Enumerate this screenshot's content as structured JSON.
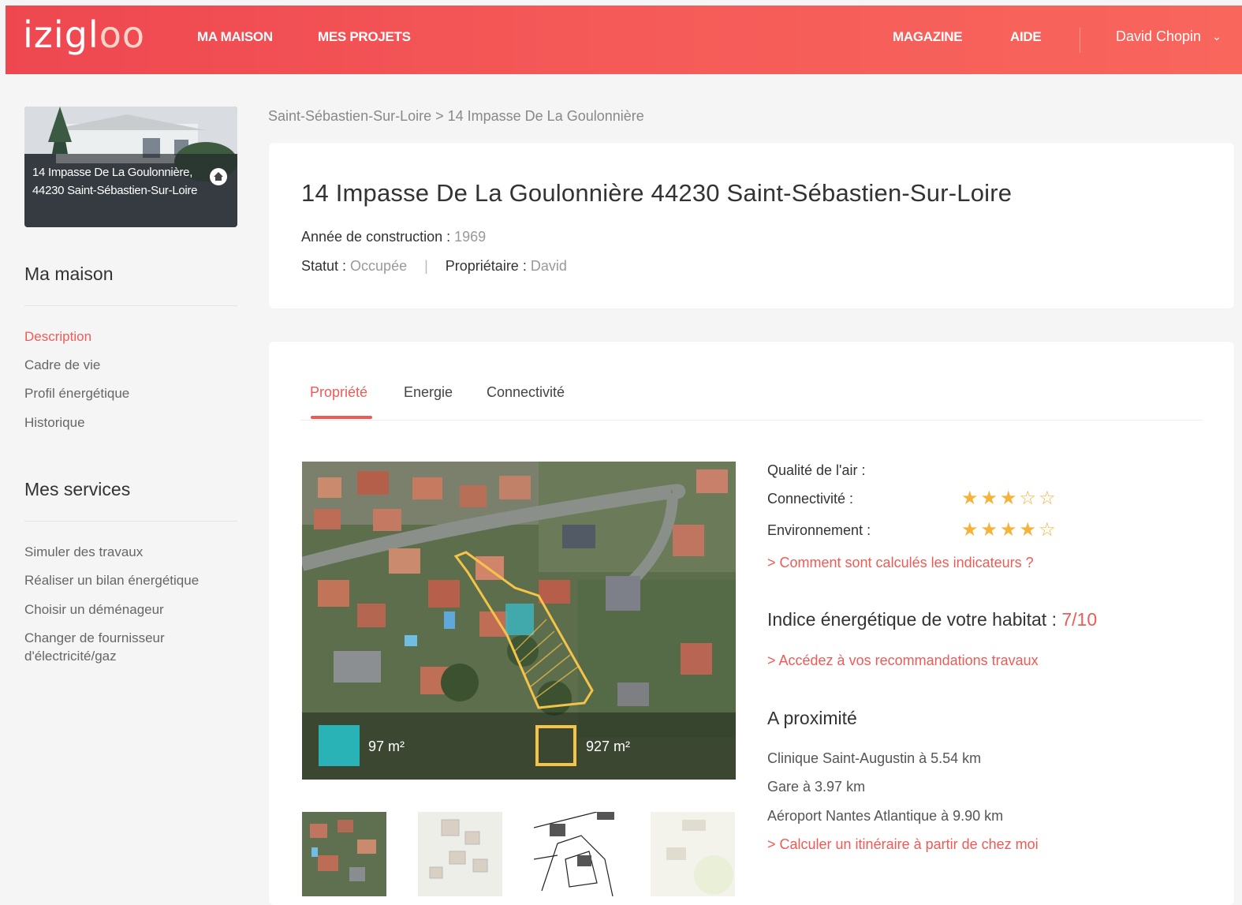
{
  "header": {
    "logo_main": "izigl",
    "logo_oo": "oo",
    "nav": [
      "MA MAISON",
      "MES PROJETS"
    ],
    "nav_right": [
      "MAGAZINE",
      "AIDE"
    ],
    "user_name": "David Chopin"
  },
  "sidebar": {
    "house_address": "14 Impasse De La Goulonnière, 44230 Saint-Sébastien-Sur-Loire",
    "section1_title": "Ma maison",
    "section1_items": [
      "Description",
      "Cadre de vie",
      "Profil énergétique",
      "Historique"
    ],
    "section2_title": "Mes services",
    "section2_items": [
      "Simuler des travaux",
      "Réaliser un bilan énergétique",
      "Choisir un déménageur",
      "Changer de fournisseur d'électricité/gaz"
    ]
  },
  "breadcrumb": "Saint-Sébastien-Sur-Loire > 14 Impasse De La Goulonnière",
  "property": {
    "title": "14 Impasse De La Goulonnière 44230 Saint-Sébastien-Sur-Loire",
    "year_label": "Année de construction",
    "year_value": "1969",
    "status_label": "Statut",
    "status_value": "Occupée",
    "owner_label": "Propriétaire",
    "owner_value": "David"
  },
  "tabs": [
    "Propriété",
    "Energie",
    "Connectivité"
  ],
  "map": {
    "area_house": "97 m²",
    "area_plot": "927 m²"
  },
  "indicators": {
    "air_label": "Qualité de l'air :",
    "connect_label": "Connectivité :",
    "connect_rating": 3,
    "env_label": "Environnement :",
    "env_rating": 4,
    "rating_max": 5,
    "how_link": "> Comment sont calculés les indicateurs ?"
  },
  "energy": {
    "title": "Indice énergétique de votre habitat :",
    "score": "7/10",
    "link": "> Accédez à vos recommandations travaux"
  },
  "nearby": {
    "title": "A proximité",
    "items": [
      "Clinique Saint-Augustin à 5.54 km",
      "Gare à 3.97 km",
      "Aéroport Nantes Atlantique à 9.90 km"
    ],
    "link": "> Calculer un itinéraire à partir de chez moi"
  }
}
